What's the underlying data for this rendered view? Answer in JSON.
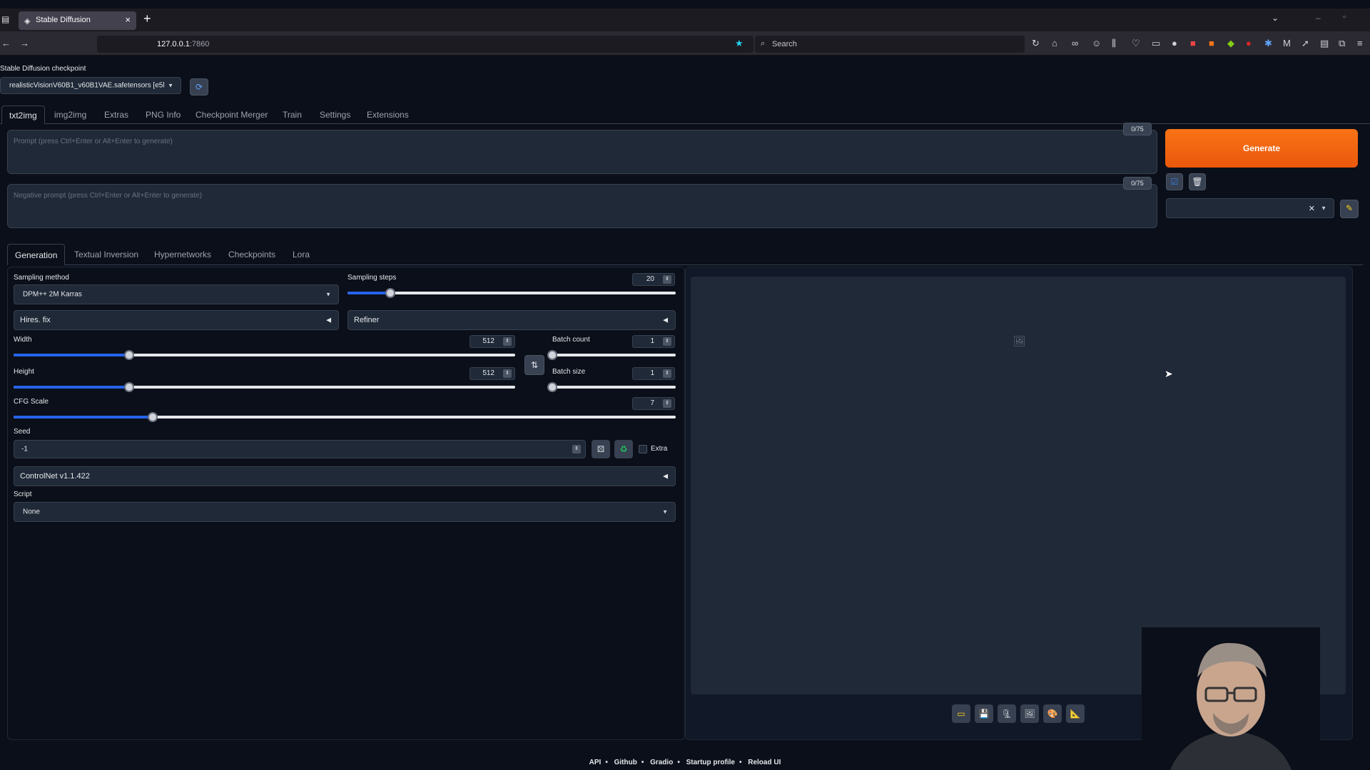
{
  "browser": {
    "tab_title": "Stable Diffusion",
    "url_host": "127.0.0.1",
    "url_port": ":7860",
    "search_placeholder": "Search"
  },
  "checkpoint": {
    "label": "Stable Diffusion checkpoint",
    "value": "realisticVisionV60B1_v60B1VAE.safetensors [e5l"
  },
  "main_tabs": [
    "txt2img",
    "img2img",
    "Extras",
    "PNG Info",
    "Checkpoint Merger",
    "Train",
    "Settings",
    "Extensions"
  ],
  "prompt": {
    "placeholder": "Prompt (press Ctrl+Enter or Alt+Enter to generate)",
    "token_count": "0/75"
  },
  "negative_prompt": {
    "placeholder": "Negative prompt (press Ctrl+Enter or Alt+Enter to generate)",
    "token_count": "0/75"
  },
  "generate_label": "Generate",
  "sub_tabs": [
    "Generation",
    "Textual Inversion",
    "Hypernetworks",
    "Checkpoints",
    "Lora"
  ],
  "sampling": {
    "method_label": "Sampling method",
    "method_value": "DPM++ 2M Karras",
    "steps_label": "Sampling steps",
    "steps_value": "20",
    "steps_fraction": 0.13
  },
  "hires_label": "Hires. fix",
  "refiner_label": "Refiner",
  "width": {
    "label": "Width",
    "value": "512",
    "fraction": 0.23
  },
  "height": {
    "label": "Height",
    "value": "512",
    "fraction": 0.23
  },
  "batch_count": {
    "label": "Batch count",
    "value": "1",
    "fraction": 0.0
  },
  "batch_size": {
    "label": "Batch size",
    "value": "1",
    "fraction": 0.0
  },
  "cfg": {
    "label": "CFG Scale",
    "value": "7",
    "fraction": 0.21
  },
  "seed": {
    "label": "Seed",
    "value": "-1",
    "extra_label": "Extra"
  },
  "controlnet_label": "ControlNet v1.1.422",
  "script": {
    "label": "Script",
    "value": "None"
  },
  "footer": [
    "API",
    "Github",
    "Gradio",
    "Startup profile",
    "Reload UI"
  ]
}
